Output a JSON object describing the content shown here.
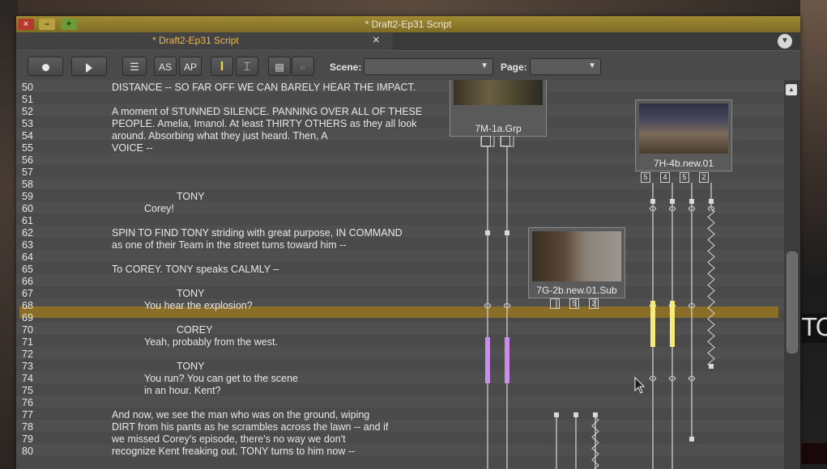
{
  "window": {
    "title": "* Draft2-Ep31 Script"
  },
  "tab": {
    "label": "* Draft2-Ep31 Script",
    "close": "×"
  },
  "toolbar": {
    "as_label": "AS",
    "ap_label": "AP",
    "scene_label": "Scene:",
    "scene_value": "",
    "page_label": "Page:",
    "page_value": ""
  },
  "script_lines": [
    {
      "n": "50",
      "t": "DISTANCE -- SO FAR OFF WE CAN BARELY HEAR THE IMPACT.",
      "indent": "action"
    },
    {
      "n": "51",
      "t": "",
      "indent": "action"
    },
    {
      "n": "52",
      "t": "A moment of STUNNED SILENCE. PANNING OVER ALL OF THESE",
      "indent": "action"
    },
    {
      "n": "53",
      "t": "PEOPLE. Amelia, Imanol. At least THIRTY OTHERS as they all look",
      "indent": "action"
    },
    {
      "n": "54",
      "t": "around. Absorbing what they just heard. Then, A",
      "indent": "action"
    },
    {
      "n": "55",
      "t": "VOICE --",
      "indent": "action"
    },
    {
      "n": "56",
      "t": "",
      "indent": "action"
    },
    {
      "n": "57",
      "t": "",
      "indent": "action"
    },
    {
      "n": "58",
      "t": "",
      "indent": "action"
    },
    {
      "n": "59",
      "t": "TONY",
      "indent": "char"
    },
    {
      "n": "60",
      "t": "Corey!",
      "indent": "dial"
    },
    {
      "n": "61",
      "t": "",
      "indent": "action"
    },
    {
      "n": "62",
      "t": "SPIN TO FIND TONY striding with great purpose, IN COMMAND",
      "indent": "action"
    },
    {
      "n": "63",
      "t": "as one of their Team in the street turns toward him --",
      "indent": "action"
    },
    {
      "n": "64",
      "t": "",
      "indent": "action"
    },
    {
      "n": "65",
      "t": "To COREY. TONY speaks CALMLY –",
      "indent": "action"
    },
    {
      "n": "66",
      "t": "",
      "indent": "action"
    },
    {
      "n": "67",
      "t": "TONY",
      "indent": "char"
    },
    {
      "n": "68",
      "t": "You hear the explosion?",
      "indent": "dial"
    },
    {
      "n": "69",
      "t": "",
      "indent": "action"
    },
    {
      "n": "70",
      "t": "COREY",
      "indent": "char"
    },
    {
      "n": "71",
      "t": "Yeah, probably from the west.",
      "indent": "dial"
    },
    {
      "n": "72",
      "t": "",
      "indent": "action"
    },
    {
      "n": "73",
      "t": "TONY",
      "indent": "char"
    },
    {
      "n": "74",
      "t": "You run? You can get to the scene",
      "indent": "dial"
    },
    {
      "n": "75",
      "t": "in an hour. Kent?",
      "indent": "dial"
    },
    {
      "n": "76",
      "t": "",
      "indent": "action"
    },
    {
      "n": "77",
      "t": "And now, we see the man who was on the ground, wiping",
      "indent": "action"
    },
    {
      "n": "78",
      "t": "DIRT from his pants as he scrambles across the lawn -- and if",
      "indent": "action"
    },
    {
      "n": "79",
      "t": "we missed Corey's episode, there's no way we don't",
      "indent": "action"
    },
    {
      "n": "80",
      "t": "recognize Kent freaking out. TONY turns to him now --",
      "indent": "action"
    }
  ],
  "clips": [
    {
      "name": "7M-1a.Grp",
      "tracks": [
        "",
        ""
      ]
    },
    {
      "name": "7H-4b.new.01",
      "tracks": [
        "5",
        "4",
        "5",
        "2"
      ]
    },
    {
      "name": "7G-2b.new.01.Sub",
      "tracks": [
        "",
        "5",
        "2"
      ]
    }
  ],
  "colors": {
    "highlight": "#8a6d26",
    "take_purple": "#c98ee8",
    "take_yellow": "#f4ec7a",
    "title_gold": "#f2b84a"
  }
}
